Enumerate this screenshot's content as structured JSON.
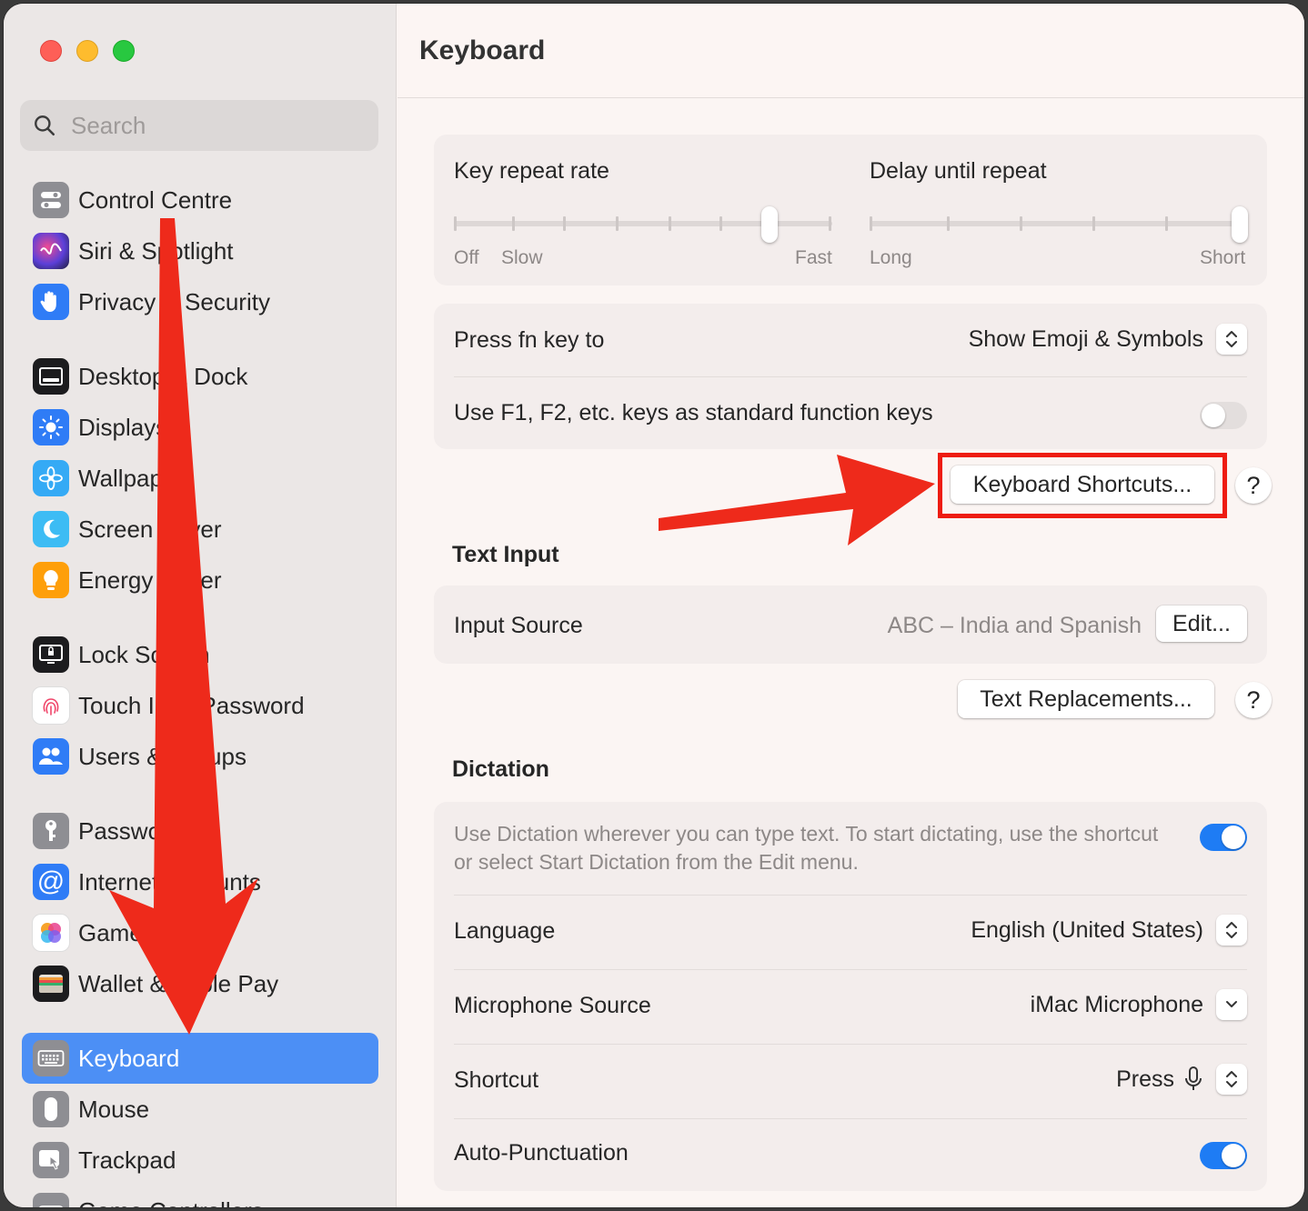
{
  "window": {
    "title": "Keyboard"
  },
  "search": {
    "placeholder": "Search"
  },
  "sidebar": {
    "items": [
      {
        "label": "Control Centre",
        "icon": "control-centre-icon",
        "color": "#8e8e93"
      },
      {
        "label": "Siri & Spotlight",
        "icon": "siri-icon",
        "color": "#5b3fd8"
      },
      {
        "label": "Privacy & Security",
        "icon": "hand-icon",
        "color": "#2f7cf6"
      },
      {
        "label": "Desktop & Dock",
        "icon": "dock-icon",
        "color": "#1c1c1e"
      },
      {
        "label": "Displays",
        "icon": "sun-icon",
        "color": "#2f7cf6"
      },
      {
        "label": "Wallpaper",
        "icon": "flower-icon",
        "color": "#35aaf5"
      },
      {
        "label": "Screen Saver",
        "icon": "moon-icon",
        "color": "#3dbcf4"
      },
      {
        "label": "Energy Saver",
        "icon": "bulb-icon",
        "color": "#fe9f0a"
      },
      {
        "label": "Lock Screen",
        "icon": "lock-screen-icon",
        "color": "#1c1c1e"
      },
      {
        "label": "Touch ID & Password",
        "icon": "fingerprint-icon",
        "color": "#ffffff"
      },
      {
        "label": "Users & Groups",
        "icon": "users-icon",
        "color": "#2f7cf6"
      },
      {
        "label": "Passwords",
        "icon": "key-icon",
        "color": "#8e8e93"
      },
      {
        "label": "Internet Accounts",
        "icon": "at-icon",
        "color": "#2f7cf6"
      },
      {
        "label": "Game Center",
        "icon": "game-center-icon",
        "color": "#ffffff"
      },
      {
        "label": "Wallet & Apple Pay",
        "icon": "wallet-icon",
        "color": "#1c1c1e"
      },
      {
        "label": "Keyboard",
        "icon": "keyboard-icon",
        "color": "#8e8e93",
        "selected": true
      },
      {
        "label": "Mouse",
        "icon": "mouse-icon",
        "color": "#8e8e93"
      },
      {
        "label": "Trackpad",
        "icon": "trackpad-icon",
        "color": "#8e8e93"
      },
      {
        "label": "Game Controllers",
        "icon": "gamepad-icon",
        "color": "#8e8e93"
      }
    ]
  },
  "key_repeat": {
    "label": "Key repeat rate",
    "min_label": "Off",
    "slow_label": "Slow",
    "max_label": "Fast",
    "value_fraction": 0.85
  },
  "delay_repeat": {
    "label": "Delay until repeat",
    "min_label": "Long",
    "max_label": "Short",
    "value_fraction": 1.0
  },
  "fn_key": {
    "label": "Press fn key to",
    "value": "Show Emoji & Symbols"
  },
  "function_keys": {
    "label": "Use F1, F2, etc. keys as standard function keys",
    "enabled": false
  },
  "keyboard_shortcuts_button": "Keyboard Shortcuts...",
  "help_label": "?",
  "text_input": {
    "section_title": "Text Input",
    "input_source_label": "Input Source",
    "input_source_value": "ABC – India and Spanish",
    "edit_button": "Edit...",
    "text_replacements_button": "Text Replacements..."
  },
  "dictation": {
    "section_title": "Dictation",
    "description": "Use Dictation wherever you can type text. To start dictating, use the shortcut or select Start Dictation from the Edit menu.",
    "enabled": true,
    "language_label": "Language",
    "language_value": "English (United States)",
    "mic_label": "Microphone Source",
    "mic_value": "iMac Microphone",
    "shortcut_label": "Shortcut",
    "shortcut_value": "Press",
    "autopunct_label": "Auto-Punctuation",
    "autopunct_enabled": true
  },
  "colors": {
    "accent": "#1e7cf4",
    "selection": "#4c8ff5",
    "annotation": "#ee1c12"
  }
}
